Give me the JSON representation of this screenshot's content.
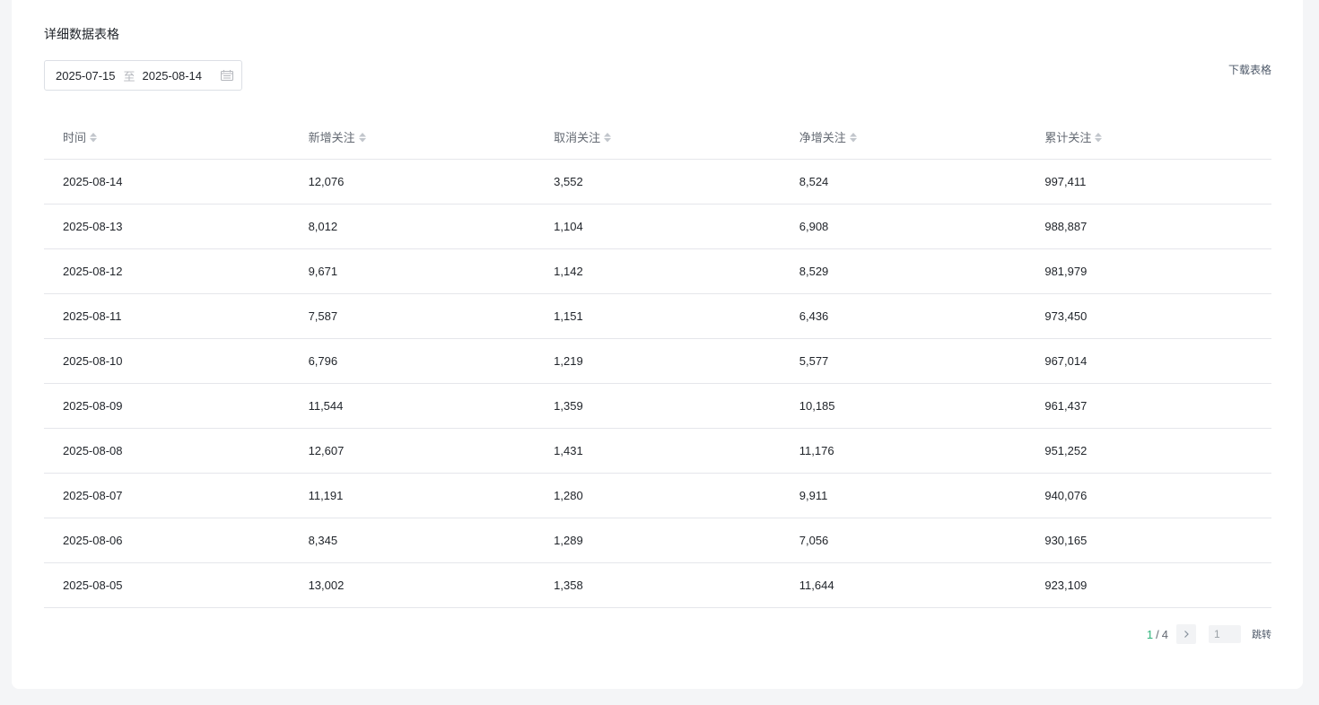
{
  "section": {
    "title": "详细数据表格",
    "download_label": "下载表格"
  },
  "date_range": {
    "start": "2025-07-15",
    "separator": "至",
    "end": "2025-08-14"
  },
  "table": {
    "columns": [
      "时间",
      "新增关注",
      "取消关注",
      "净增关注",
      "累计关注"
    ],
    "rows": [
      [
        "2025-08-14",
        "12,076",
        "3,552",
        "8,524",
        "997,411"
      ],
      [
        "2025-08-13",
        "8,012",
        "1,104",
        "6,908",
        "988,887"
      ],
      [
        "2025-08-12",
        "9,671",
        "1,142",
        "8,529",
        "981,979"
      ],
      [
        "2025-08-11",
        "7,587",
        "1,151",
        "6,436",
        "973,450"
      ],
      [
        "2025-08-10",
        "6,796",
        "1,219",
        "5,577",
        "967,014"
      ],
      [
        "2025-08-09",
        "11,544",
        "1,359",
        "10,185",
        "961,437"
      ],
      [
        "2025-08-08",
        "12,607",
        "1,431",
        "11,176",
        "951,252"
      ],
      [
        "2025-08-07",
        "11,191",
        "1,280",
        "9,911",
        "940,076"
      ],
      [
        "2025-08-06",
        "8,345",
        "1,289",
        "7,056",
        "930,165"
      ],
      [
        "2025-08-05",
        "13,002",
        "1,358",
        "11,644",
        "923,109"
      ]
    ]
  },
  "pagination": {
    "current": "1",
    "separator": "/",
    "total": "4",
    "jump_value": "1",
    "jump_label": "跳转"
  },
  "icons": {
    "sort": "sort-icon",
    "calendar": "calendar-icon",
    "next": "chevron-right-icon"
  },
  "colors": {
    "accent": "#2fb47c",
    "border": "#e5e6eb",
    "background": "#f4f5f7"
  }
}
